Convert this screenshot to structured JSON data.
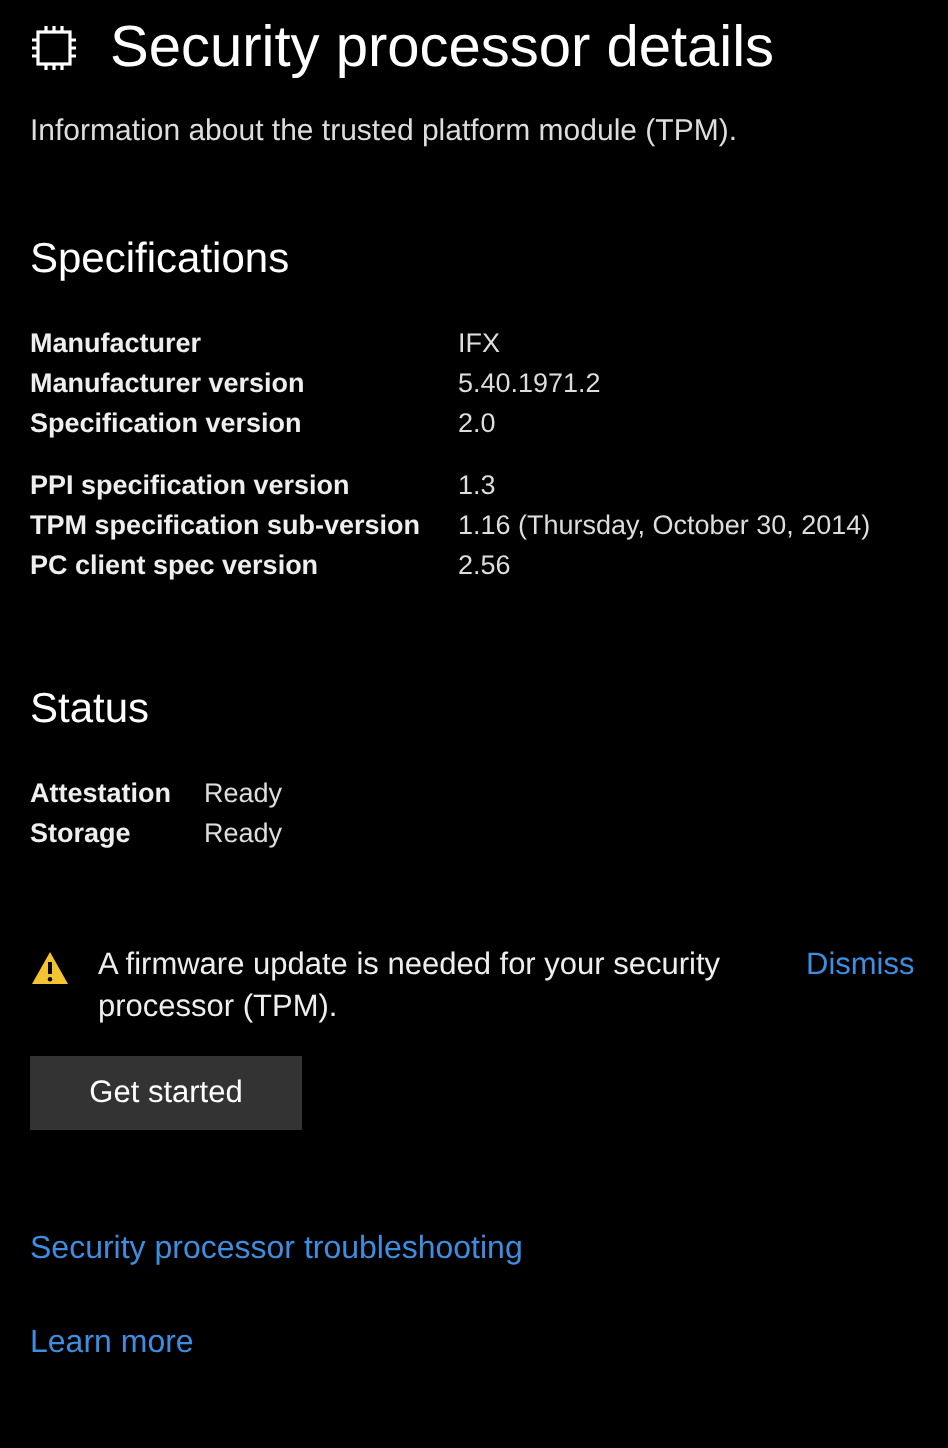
{
  "title": "Security processor details",
  "subtitle": "Information about the trusted platform module (TPM).",
  "specifications": {
    "heading": "Specifications",
    "groups": [
      [
        {
          "label": "Manufacturer",
          "value": "IFX"
        },
        {
          "label": "Manufacturer version",
          "value": "5.40.1971.2"
        },
        {
          "label": "Specification version",
          "value": "2.0"
        }
      ],
      [
        {
          "label": "PPI specification version",
          "value": "1.3"
        },
        {
          "label": "TPM specification sub-version",
          "value": "1.16 (Thursday, October 30, 2014)"
        },
        {
          "label": "PC client spec version",
          "value": "2.56"
        }
      ]
    ]
  },
  "status": {
    "heading": "Status",
    "rows": [
      {
        "label": "Attestation",
        "value": "Ready"
      },
      {
        "label": "Storage",
        "value": "Ready"
      }
    ]
  },
  "warning": {
    "message": "A firmware update is needed for your security processor (TPM).",
    "dismiss": "Dismiss"
  },
  "button": "Get started",
  "links": [
    "Security processor troubleshooting",
    "Learn more"
  ]
}
